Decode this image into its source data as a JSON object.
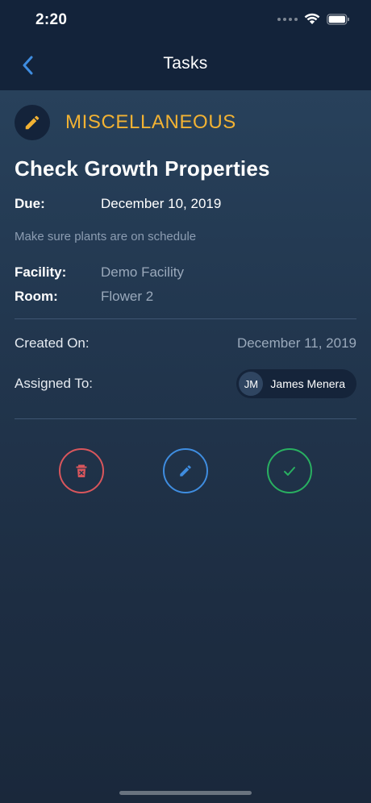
{
  "status_bar": {
    "time": "2:20"
  },
  "nav": {
    "title": "Tasks"
  },
  "task": {
    "category": "MISCELLANEOUS",
    "title": "Check Growth Properties",
    "due_label": "Due:",
    "due_value": "December 10, 2019",
    "description": "Make sure plants are on schedule",
    "facility_label": "Facility:",
    "facility_value": "Demo Facility",
    "room_label": "Room:",
    "room_value": "Flower 2",
    "created_label": "Created On:",
    "created_value": "December 11, 2019",
    "assigned_label": "Assigned To:",
    "assignee": {
      "initials": "JM",
      "name": "James Menera"
    }
  },
  "icons": {
    "back": "chevron-left-icon",
    "category": "pencil-icon",
    "delete": "trash-icon",
    "edit": "pencil-icon",
    "complete": "checkmark-icon"
  },
  "colors": {
    "accent": "#f2b233",
    "delete": "#d9565c",
    "edit": "#3f8de0",
    "complete": "#29b061",
    "back": "#3f8de0"
  }
}
